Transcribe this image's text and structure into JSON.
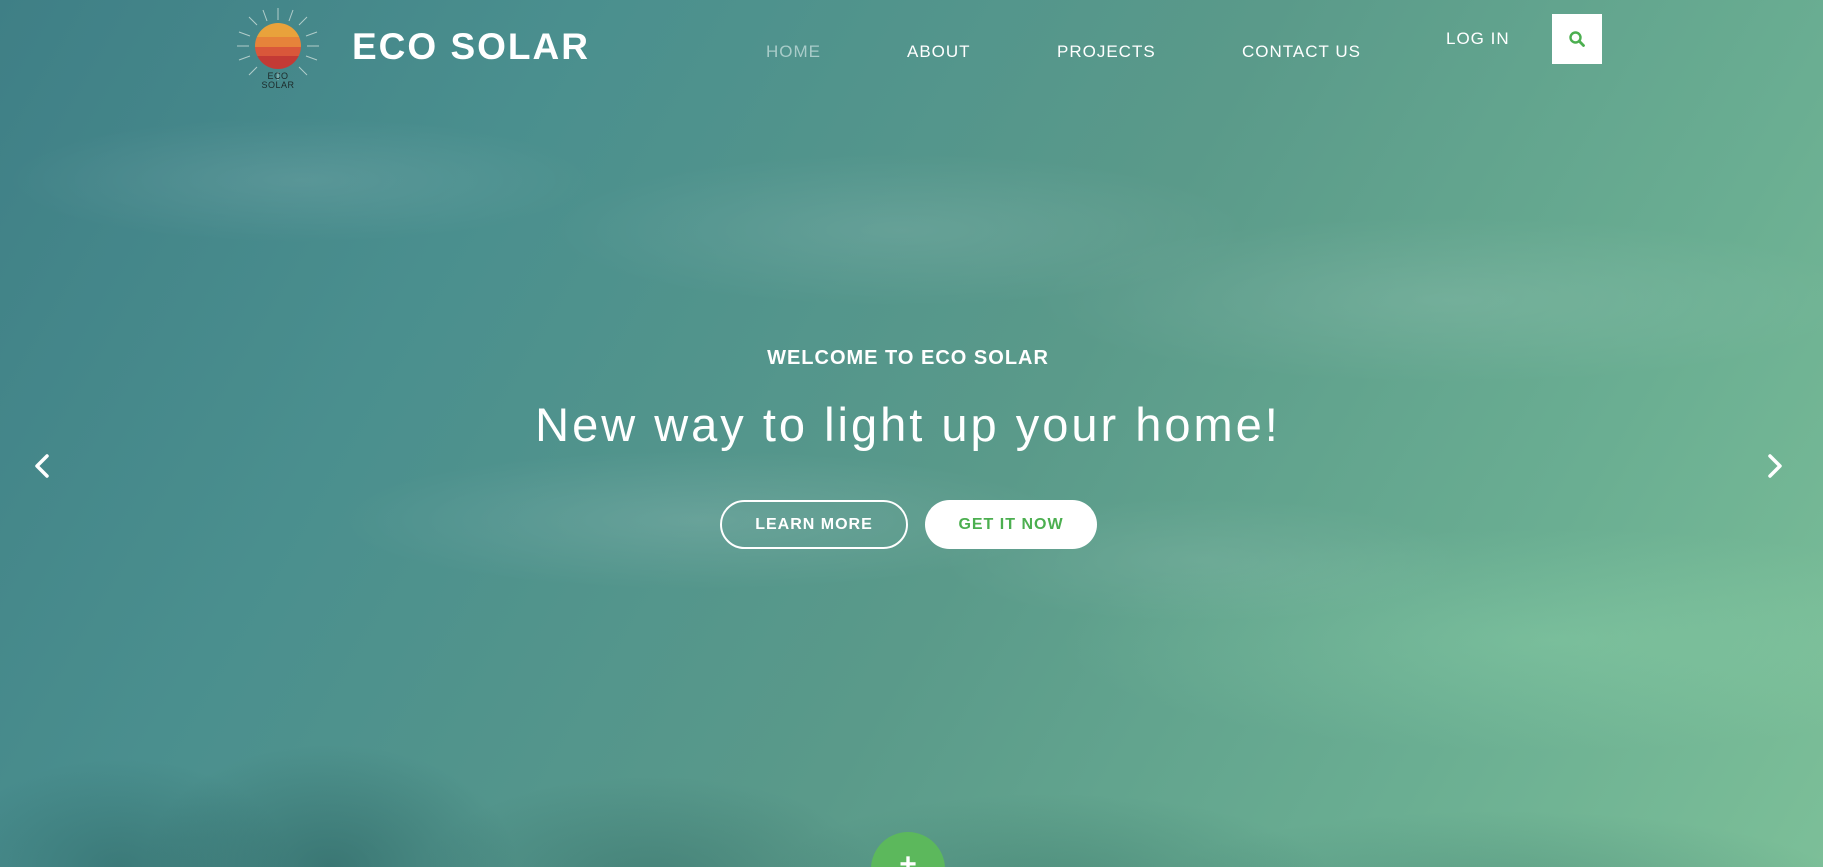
{
  "brand": {
    "logo_text_line1": "ECO",
    "logo_text_line2": "SOLAR",
    "name": "ECO SOLAR"
  },
  "nav": {
    "items": [
      {
        "label": "HOME",
        "active": true
      },
      {
        "label": "ABOUT",
        "active": false
      },
      {
        "label": "PROJECTS",
        "active": false
      },
      {
        "label": "CONTACT US",
        "active": false
      }
    ],
    "login_label": "LOG IN",
    "search_icon": "search-icon"
  },
  "hero": {
    "eyebrow": "WELCOME TO ECO SOLAR",
    "headline": "New way to light up your home!",
    "primary_button": "LEARN MORE",
    "secondary_button": "GET IT NOW",
    "prev_icon": "chevron-left-icon",
    "next_icon": "chevron-right-icon",
    "fab_label": "+"
  },
  "colors": {
    "accent_green": "#4caf50",
    "fab_green": "#5cb85c",
    "active_nav": "#a9ccc9",
    "text": "#ffffff"
  }
}
